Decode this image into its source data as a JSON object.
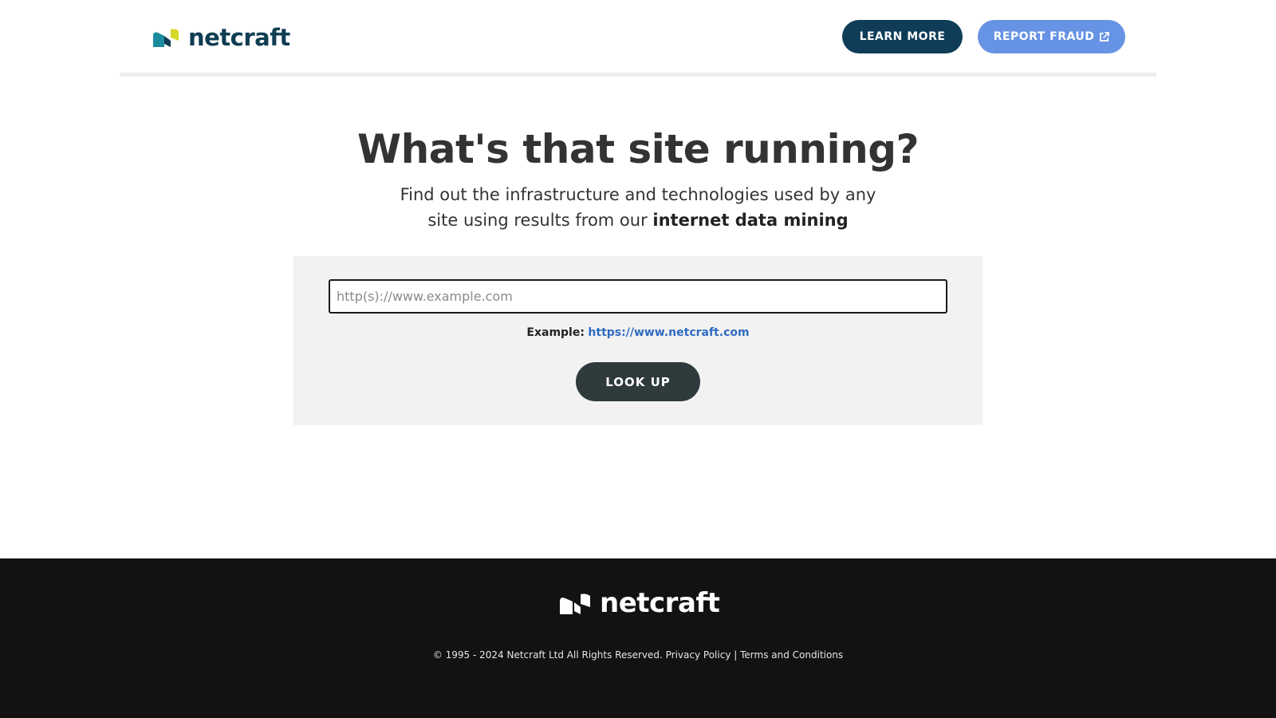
{
  "header": {
    "logo_text": "netcraft",
    "learn_more_label": "LEARN MORE",
    "report_fraud_label": "REPORT FRAUD",
    "report_fraud_icon": "external-link-icon"
  },
  "hero": {
    "title": "What's that site running?",
    "subtitle_plain": "Find out the infrastructure and technologies used by any site using results from our ",
    "subtitle_bold": "internet data mining"
  },
  "search": {
    "placeholder": "http(s)://www.example.com",
    "value": "",
    "example_label": "Example:",
    "example_link": "https://www.netcraft.com",
    "button_label": "LOOK UP"
  },
  "footer": {
    "logo_text": "netcraft",
    "copyright": "© 1995 - 2024 Netcraft Ltd All Rights Reserved.",
    "privacy_label": "Privacy Policy",
    "separator": "|",
    "terms_label": "Terms and Conditions"
  },
  "colors": {
    "brand_navy": "#0f3d58",
    "brand_blue": "#6693e4",
    "lookup_button": "#2f3a3c",
    "footer_bg": "#121212",
    "link_blue": "#2f6bc1"
  }
}
